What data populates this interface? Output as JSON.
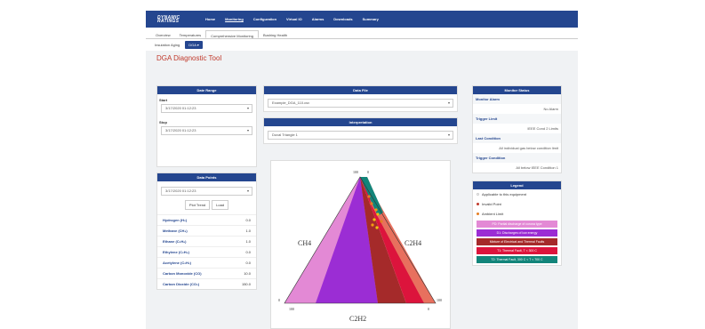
{
  "brand": {
    "line1": "DYNAMIC",
    "line2": "RATINGS"
  },
  "topnav": [
    "Home",
    "Monitoring",
    "Configuration",
    "Virtual IO",
    "Alarms",
    "Downloads",
    "Summary"
  ],
  "tabs": [
    "Overview",
    "Temperatures",
    "Comprehensive Monitoring",
    "Bushing Health"
  ],
  "subtabs": {
    "insulation": "Insulation Aging",
    "dga": "DGA ▾"
  },
  "page_title": "DGA Diagnostic Tool",
  "date_range": {
    "header": "Date Range",
    "start_label": "Start",
    "start_value": "3/17/2020 01:12:23",
    "stop_label": "Stop",
    "stop_value": "3/17/2020 01:12:23"
  },
  "data_points": {
    "header": "Data Points",
    "value": "3/17/2020 01:12:23",
    "btn_plot": "Plot Trend",
    "btn_load": "Load",
    "gases": [
      {
        "name": "Hydrogen (H₂)",
        "value": "0.0"
      },
      {
        "name": "Methane (CH₄)",
        "value": "1.0"
      },
      {
        "name": "Ethane (C₂H₆)",
        "value": "1.0"
      },
      {
        "name": "Ethylene (C₂H₄)",
        "value": "0.0"
      },
      {
        "name": "Acetylene (C₂H₂)",
        "value": "0.0"
      },
      {
        "name": "Carbon Monoxide (CO)",
        "value": "10.0"
      },
      {
        "name": "Carbon Dioxide (CO₂)",
        "value": "150.0"
      }
    ]
  },
  "data_file": {
    "header": "Data File",
    "value": "Example_DGA_110.csv"
  },
  "interpretation": {
    "header": "Interpretation",
    "value": "Duval Triangle 1"
  },
  "triangle": {
    "labels": {
      "left": "CH4",
      "right": "C2H4",
      "bottom": "C2H2"
    },
    "ticks": [
      "100",
      "0",
      "0",
      "100",
      "100",
      "0"
    ]
  },
  "monitor_status": {
    "header": "Monitor Status",
    "rows": [
      {
        "label": "Monitor Alarm",
        "value": "No Alarm"
      },
      {
        "label": "Trigger Limit",
        "value": "IEEE Cond 2 Limits"
      },
      {
        "label": "Last Condition",
        "value": "All individual gas below condition limit"
      },
      {
        "label": "Trigger Condition",
        "value": "All below IEEE Condition 1"
      }
    ]
  },
  "legend": {
    "header": "Legend",
    "items": [
      {
        "label": "Applicable to this equipment",
        "color": "#ffffff",
        "dot": "#cccccc"
      },
      {
        "label": "Invalid Point",
        "color": "#ffffff",
        "dot": "#c0392b"
      },
      {
        "label": "Ambient Limit",
        "color": "#ffffff",
        "dot": "#e67e22"
      }
    ],
    "swatches": [
      {
        "label": "PD: Partial discharge of corona type",
        "color": "#e389d5"
      },
      {
        "label": "D1: Discharges of low energy",
        "color": "#9b2dd4"
      },
      {
        "label": "Mixture of Electrical and Thermal Faults",
        "color": "#a52a2a"
      },
      {
        "label": "T1: Thermal Fault, T < 300 C",
        "color": "#dc143c"
      },
      {
        "label": "T2: Thermal Fault, 300 C < T < 700 C",
        "color": "#12857a"
      }
    ]
  }
}
